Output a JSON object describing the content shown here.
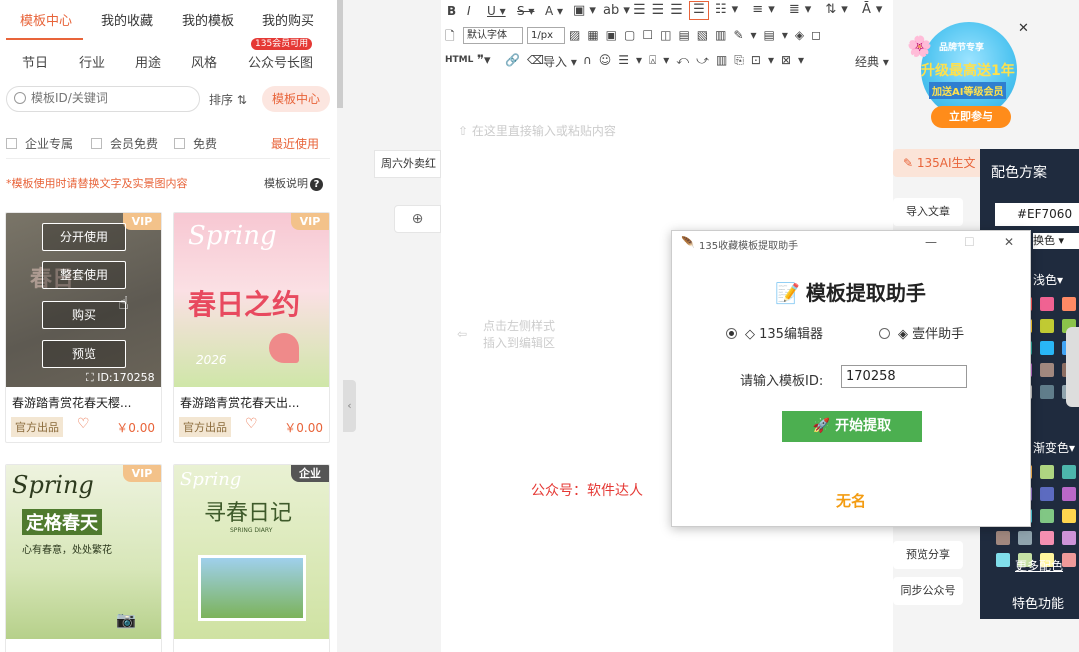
{
  "left_panel": {
    "tabs": [
      {
        "label": "模板中心"
      },
      {
        "label": "我的收藏"
      },
      {
        "label": "我的模板"
      },
      {
        "label": "我的购买"
      }
    ],
    "categories": [
      "节日",
      "行业",
      "用途",
      "风格",
      "公众号长图"
    ],
    "new_badge": "135会员可用",
    "search": {
      "placeholder": "模板ID/关键词"
    },
    "sort_label": "排序",
    "template_center_button": "模板中心",
    "filters": [
      "企业专属",
      "会员免费",
      "免费"
    ],
    "recent_label": "最近使用",
    "hint": "*模板使用时请替换文字及实景图内容",
    "help_label": "模板说明",
    "cards": [
      {
        "title": "春游踏青赏花春天樱...",
        "tag": "官方出品",
        "price": "￥0.00",
        "badge": "VIP",
        "id_label": "ID:170258",
        "overlay": [
          "分开使用",
          "整套使用",
          "购买",
          "预览"
        ],
        "thumb_text": "春日"
      },
      {
        "title": "春游踏青赏花春天出...",
        "tag": "官方出品",
        "price": "￥0.00",
        "badge": "VIP",
        "thumb_text": "春日之约",
        "thumb_sub": "Spring",
        "thumb_year": "2026"
      },
      {
        "title": "",
        "badge": "VIP",
        "thumb_text": "定格春天",
        "thumb_sub": "Spring",
        "thumb_line": "心有春意，处处繁花"
      },
      {
        "title": "",
        "badge": "企业",
        "thumb_text": "寻春日记",
        "thumb_sub": "Spring",
        "thumb_line": "SPRING DIARY"
      }
    ]
  },
  "side_tabs": {
    "tab1": "周六外卖红"
  },
  "editor": {
    "font_family": "默认字体",
    "font_size": "1/px",
    "import_label": "导入",
    "html_label": "HTML",
    "classic_label": "经典",
    "placeholder1": "在这里直接输入或粘贴内容",
    "placeholder2a": "点击左侧样式",
    "placeholder2b": "插入到编辑区",
    "watermark": "公众号：软件达人"
  },
  "right_panel": {
    "promo": {
      "line1": "品牌节专享",
      "line2": "升级最高送1年",
      "line3": "加送AI等级会员",
      "cta": "立即参与"
    },
    "ai_button": "135AI生文",
    "buttons": [
      "导入文章",
      "预览分享",
      "同步公众号"
    ],
    "color_panel": {
      "title": "配色方案",
      "hex": "#EF7060",
      "mode": "换色",
      "label1": "浅色",
      "label2": "渐变色",
      "more": "更多配色",
      "features": "特色功能",
      "swatches1": [
        "#e74c3c",
        "#ff5252",
        "#f06292",
        "#ff8a65",
        "#f5a623",
        "#ffca28",
        "#c0ca33",
        "#8bc34a",
        "#4caf50",
        "#26a69a",
        "#29b6f6",
        "#42a5f5",
        "#7e57c2",
        "#ba68c8",
        "#a1887f",
        "#8d6e63",
        "#9e9e9e",
        "#bdbdbd",
        "#607d8b",
        "#90a4ae"
      ],
      "swatches2": [
        "#ff8a80",
        "#ffb74d",
        "#aed581",
        "#4db6ac",
        "#64b5f6",
        "#9575cd",
        "#5c6bc0",
        "#ba68c8",
        "#7986cb",
        "#4dd0e1",
        "#81c784",
        "#ffd54f",
        "#a1887f",
        "#90a4ae",
        "#f48fb1",
        "#ce93d8",
        "#80deea",
        "#c5e1a5",
        "#fff59d",
        "#ef9a9a"
      ]
    }
  },
  "dialog": {
    "window_title": "135收藏模板提取助手",
    "heading": "模板提取助手",
    "radio1": "135编辑器",
    "radio2": "壹伴助手",
    "id_label": "请输入模板ID:",
    "id_value": "170258",
    "start_button": "开始提取",
    "footer": "无名"
  }
}
